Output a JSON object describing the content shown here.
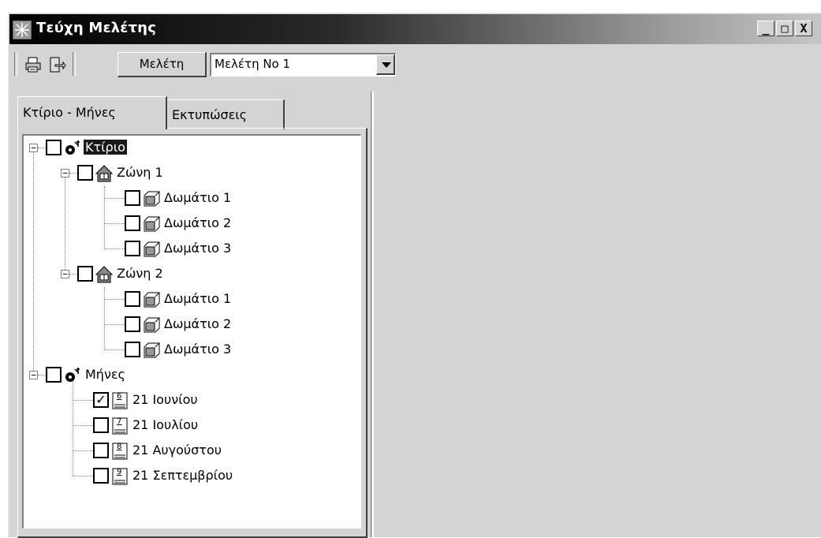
{
  "window": {
    "title": "Τεύχη Μελέτης",
    "controls": {
      "minimize": "_",
      "maximize": "□",
      "close": "X"
    }
  },
  "toolbar": {
    "print_icon": "printer-icon",
    "exit_icon": "exit-door-icon",
    "study_button_label": "Μελέτη",
    "study_select_value": "Μελέτη Νο 1"
  },
  "tabs": [
    {
      "label": "Κτίριο - Μήνες",
      "active": true
    },
    {
      "label": "Εκτυπώσεις",
      "active": false
    }
  ],
  "tree": {
    "building": {
      "label": "Κτίριο",
      "checked": false,
      "zones": [
        {
          "label": "Ζώνη 1",
          "rooms": [
            "Δωμάτιο 1",
            "Δωμάτιο 2",
            "Δωμάτιο 3"
          ]
        },
        {
          "label": "Ζώνη 2",
          "rooms": [
            "Δωμάτιο 1",
            "Δωμάτιο 2",
            "Δωμάτιο 3"
          ]
        }
      ]
    },
    "months": {
      "label": "Μήνες",
      "items": [
        {
          "label": "21 Ιουνίου",
          "day": "6",
          "checked": true
        },
        {
          "label": "21 Ιουλίου",
          "day": "7",
          "checked": false
        },
        {
          "label": "21 Αυγούστου",
          "day": "8",
          "checked": false
        },
        {
          "label": "21 Σεπτεμβρίου",
          "day": "9",
          "checked": false
        }
      ]
    }
  }
}
